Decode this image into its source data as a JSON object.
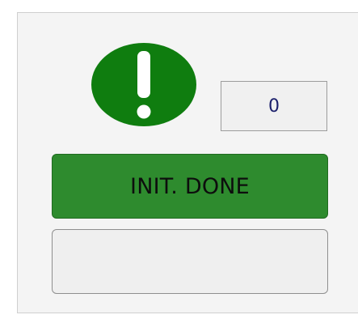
{
  "status_icon": {
    "name": "exclamation-icon",
    "color": "#0f7d0f",
    "symbol": "!"
  },
  "counter": {
    "value": "0"
  },
  "status_button": {
    "label": "INIT. DONE",
    "color": "#2e8b2e"
  },
  "secondary_button": {
    "label": ""
  }
}
